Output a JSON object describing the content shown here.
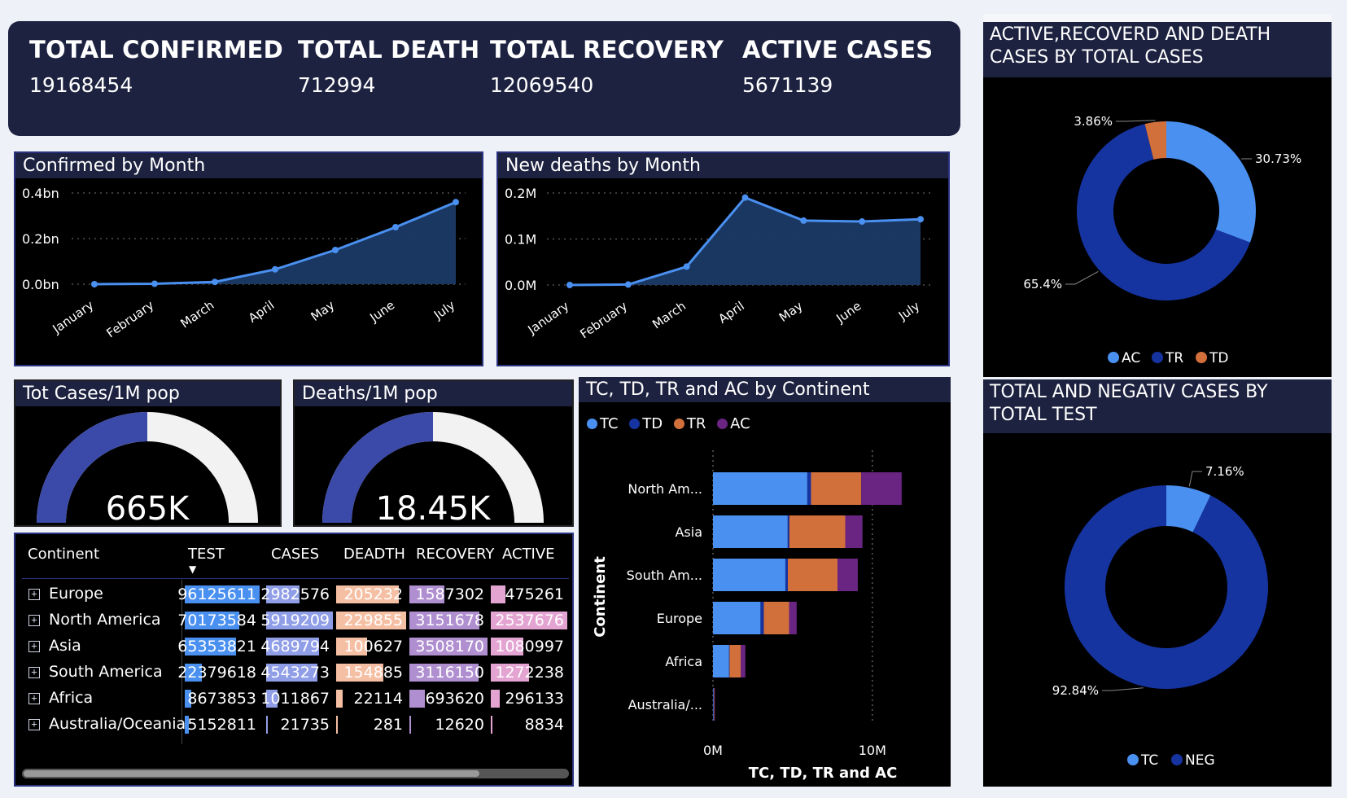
{
  "colors": {
    "tc": "#4a90f0",
    "td": "#1634a0",
    "tr": "#d2703c",
    "ac": "#6a2482",
    "gauge_fill": "#3b4aa8",
    "gauge_bg": "#f2f2f2",
    "line": "#4a90f0",
    "area": "#1b3a66",
    "donut_dark": "#1634a0",
    "donut_light": "#4a90f0",
    "donut_orange": "#d2703c"
  },
  "kpis": [
    {
      "label": "TOTAL CONFIRMED",
      "value": "19168454"
    },
    {
      "label": "TOTAL DEATH",
      "value": "712994"
    },
    {
      "label": "TOTAL RECOVERY",
      "value": "12069540"
    },
    {
      "label": "ACTIVE CASES",
      "value": "5671139"
    }
  ],
  "confirmed_chart": {
    "title": "Confirmed by Month"
  },
  "deaths_chart": {
    "title": "New deaths by Month"
  },
  "gauge_cases": {
    "title": "Tot Cases/1M pop",
    "value_label": "665K",
    "fill_fraction": 0.5
  },
  "gauge_deaths": {
    "title": "Deaths/1M pop",
    "value_label": "18.45K",
    "fill_fraction": 0.5
  },
  "continent_chart": {
    "title": "TC, TD, TR and AC by Continent",
    "legend": [
      "TC",
      "TD",
      "TR",
      "AC"
    ],
    "y_label": "Continent",
    "x_label": "TC, TD, TR and AC",
    "x_ticks": [
      "0M",
      "10M"
    ]
  },
  "donut_top": {
    "title_line1": "ACTIVE,RECOVERD AND DEATH",
    "title_line2": "CASES BY TOTAL CASES",
    "legend": [
      "AC",
      "TR",
      "TD"
    ]
  },
  "donut_bottom": {
    "title_line1": "TOTAL AND NEGATIV CASES BY",
    "title_line2": "TOTAL TEST",
    "legend": [
      "TC",
      "NEG"
    ]
  },
  "table": {
    "headers": [
      "Continent",
      "TEST",
      "CASES",
      "DEADTH",
      "RECOVERY",
      "ACTIVE"
    ],
    "sort_indicator": "▼",
    "rows": [
      {
        "continent": "Europe",
        "test": "96125611",
        "cases": "2982576",
        "death": "205232",
        "recovery": "1587302",
        "active": "475261"
      },
      {
        "continent": "North America",
        "test": "70173584",
        "cases": "5919209",
        "death": "229855",
        "recovery": "3151678",
        "active": "2537676"
      },
      {
        "continent": "Asia",
        "test": "65353821",
        "cases": "4689794",
        "death": "100627",
        "recovery": "3508170",
        "active": "1080997"
      },
      {
        "continent": "South America",
        "test": "22379618",
        "cases": "4543273",
        "death": "154885",
        "recovery": "3116150",
        "active": "1272238"
      },
      {
        "continent": "Africa",
        "test": "8673853",
        "cases": "1011867",
        "death": "22114",
        "recovery": "693620",
        "active": "296133"
      },
      {
        "continent": "Australia/Oceania",
        "test": "5152811",
        "cases": "21735",
        "death": "281",
        "recovery": "12620",
        "active": "8834"
      }
    ]
  },
  "chart_data": [
    {
      "type": "area",
      "title": "Confirmed by Month",
      "x": [
        "January",
        "February",
        "March",
        "April",
        "May",
        "June",
        "July"
      ],
      "values": [
        0.0,
        0.002,
        0.01,
        0.065,
        0.15,
        0.25,
        0.36
      ],
      "y_ticks": [
        "0.0bn",
        "0.2bn",
        "0.4bn"
      ],
      "ylim": [
        0,
        0.4
      ],
      "grid": true
    },
    {
      "type": "area",
      "title": "New deaths by Month",
      "x": [
        "January",
        "February",
        "March",
        "April",
        "May",
        "June",
        "July"
      ],
      "values": [
        0.0,
        0.001,
        0.04,
        0.19,
        0.14,
        0.138,
        0.143
      ],
      "y_ticks": [
        "0.0M",
        "0.1M",
        "0.2M"
      ],
      "ylim": [
        0,
        0.2
      ],
      "grid": true
    },
    {
      "type": "bar",
      "title": "TC, TD, TR and AC by Continent",
      "orientation": "horizontal",
      "stacked": true,
      "categories": [
        "North Am...",
        "Asia",
        "South Am...",
        "Europe",
        "Africa",
        "Australia/..."
      ],
      "series": [
        {
          "name": "TC",
          "values": [
            5919209,
            4689794,
            4543273,
            2982576,
            1011867,
            21735
          ]
        },
        {
          "name": "TD",
          "values": [
            229855,
            100627,
            154885,
            205232,
            22114,
            281
          ]
        },
        {
          "name": "TR",
          "values": [
            3151678,
            3508170,
            3116150,
            1587302,
            693620,
            12620
          ]
        },
        {
          "name": "AC",
          "values": [
            2537676,
            1080997,
            1272238,
            475261,
            296133,
            8834
          ]
        }
      ],
      "xlim": [
        0,
        12000000
      ],
      "x_ticks": [
        "0M",
        "10M"
      ]
    },
    {
      "type": "pie",
      "title": "ACTIVE,RECOVERD AND DEATH CASES BY TOTAL CASES",
      "donut": true,
      "slices": [
        {
          "name": "AC",
          "value": 30.73,
          "label": "30.73%"
        },
        {
          "name": "TR",
          "value": 65.4,
          "label": "65.4%"
        },
        {
          "name": "TD",
          "value": 3.86,
          "label": "3.86%"
        }
      ]
    },
    {
      "type": "pie",
      "title": "TOTAL AND NEGATIV CASES BY TOTAL TEST",
      "donut": true,
      "slices": [
        {
          "name": "TC",
          "value": 7.16,
          "label": "7.16%"
        },
        {
          "name": "NEG",
          "value": 92.84,
          "label": "92.84%"
        }
      ]
    }
  ]
}
